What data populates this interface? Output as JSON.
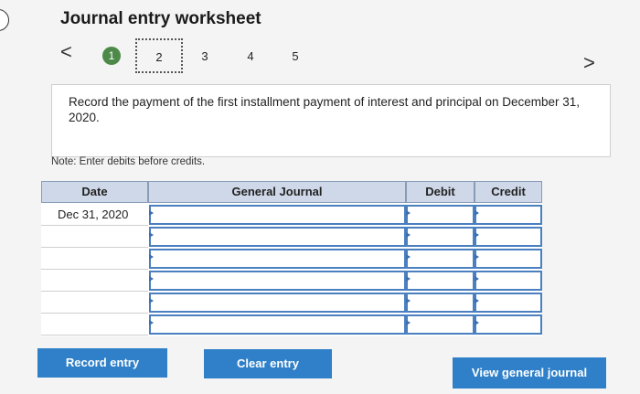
{
  "header": {
    "title": "Journal entry worksheet",
    "prev_icon": "<",
    "next_icon": ">"
  },
  "steps": [
    "1",
    "2",
    "3",
    "4",
    "5"
  ],
  "prompt": {
    "text": "Record the payment of the first installment payment of interest and principal on December 31, 2020."
  },
  "note": "Note: Enter debits before credits.",
  "journal": {
    "columns": {
      "date": "Date",
      "general_journal": "General Journal",
      "debit": "Debit",
      "credit": "Credit"
    },
    "rows": [
      {
        "date": "Dec 31, 2020",
        "account": "",
        "debit": "",
        "credit": ""
      },
      {
        "date": "",
        "account": "",
        "debit": "",
        "credit": ""
      },
      {
        "date": "",
        "account": "",
        "debit": "",
        "credit": ""
      },
      {
        "date": "",
        "account": "",
        "debit": "",
        "credit": ""
      },
      {
        "date": "",
        "account": "",
        "debit": "",
        "credit": ""
      },
      {
        "date": "",
        "account": "",
        "debit": "",
        "credit": ""
      }
    ]
  },
  "buttons": {
    "record": "Record entry",
    "clear": "Clear entry",
    "view": "View general journal"
  },
  "colors": {
    "button_blue": "#2f80c8",
    "header_bg": "#cfd8e8",
    "step_active": "#4d8a4a",
    "cell_border": "#4a7fc0"
  }
}
